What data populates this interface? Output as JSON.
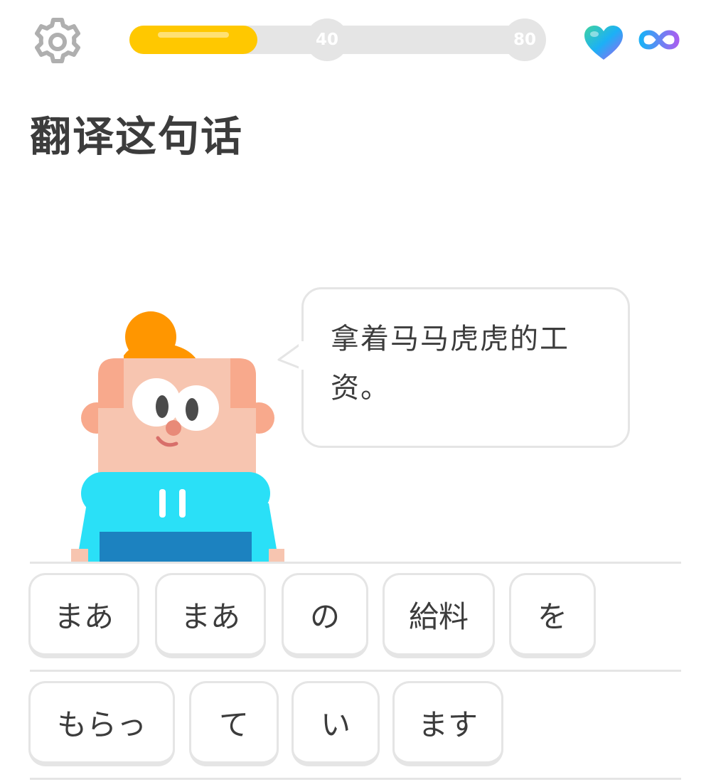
{
  "header": {
    "settings_icon": "gear-icon",
    "progress": {
      "fill_fraction": 0.31,
      "checkpoints": [
        "40",
        "80"
      ]
    },
    "hearts_icon": "heart-icon",
    "hearts_display": "infinity-icon"
  },
  "title": "翻译这句话",
  "prompt": {
    "text": "拿着马马虎虎的工资。"
  },
  "word_bank": {
    "row1": [
      "まあ",
      "まあ",
      "の",
      "給料",
      "を"
    ],
    "row2": [
      "もらっ",
      "て",
      "い",
      "ます"
    ]
  },
  "colors": {
    "progress_fill": "#ffc800",
    "track": "#e5e5e5",
    "text": "#3c3c3c",
    "border": "#e5e5e5"
  }
}
